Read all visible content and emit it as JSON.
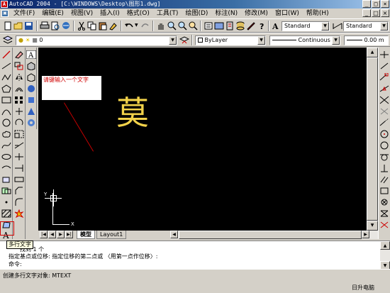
{
  "window": {
    "title": "AutoCAD 2004 - [C:\\WINDOWS\\Desktop\\图形1.dwg]",
    "app_icon": "autocad-icon",
    "buttons": [
      "_",
      "□",
      "×"
    ],
    "doc_buttons": [
      "_",
      "□",
      "×"
    ]
  },
  "menu": {
    "items": [
      "文件(F)",
      "编辑(E)",
      "视图(V)",
      "插入(I)",
      "格式(O)",
      "工具(T)",
      "绘图(D)",
      "标注(N)",
      "修改(M)",
      "窗口(W)",
      "帮助(H)"
    ]
  },
  "toolbar": {
    "text_style": "Standard",
    "dim_style": "Standard",
    "layer": "0",
    "color": "ByLayer",
    "linetype": "Continuous",
    "lineweight": "0.00 m"
  },
  "canvas": {
    "background": "#000000",
    "mtext_prompt": "请键输入一个文字",
    "drawn_character": "莫",
    "character_color": "#f2d24a",
    "ucs_x_label": "X",
    "ucs_y_label": "Y"
  },
  "tabs": {
    "items": [
      {
        "label": "模型",
        "active": true
      },
      {
        "label": "Layout1",
        "active": false
      }
    ]
  },
  "command": {
    "lines": [
      "找到 1 个",
      "指定基点或位移:  指定位移的第二点或 〈用第一点作位移〉:",
      "命令:"
    ],
    "tooltip": "多行文字"
  },
  "status": {
    "text": "创建多行文字对象:  MTEXT",
    "watermark": "日升电脑"
  }
}
